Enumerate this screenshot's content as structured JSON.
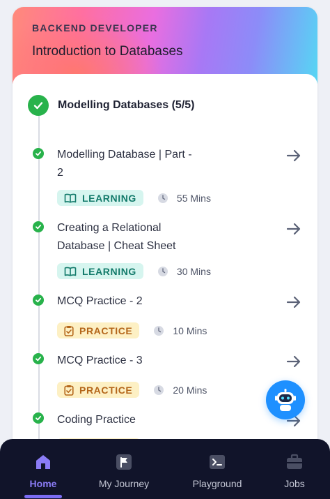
{
  "header": {
    "track": "BACKEND DEVELOPER",
    "course": "Introduction to Databases"
  },
  "module": {
    "title": "Modelling Databases (5/5)"
  },
  "items": [
    {
      "line1": "Modelling Database | Part -",
      "line2": "2",
      "type": "LEARNING",
      "duration": "55 Mins"
    },
    {
      "line1": "Creating a Relational",
      "line2": "Database | Cheat Sheet",
      "type": "LEARNING",
      "duration": "30 Mins"
    },
    {
      "line1": "MCQ Practice - 2",
      "line2": "",
      "type": "PRACTICE",
      "duration": "10 Mins"
    },
    {
      "line1": "MCQ Practice - 3",
      "line2": "",
      "type": "PRACTICE",
      "duration": "20 Mins"
    },
    {
      "line1": "Coding Practice",
      "line2": "",
      "type": "",
      "duration": ""
    }
  ],
  "nav": [
    {
      "label": "Home",
      "icon": "home-icon",
      "active": true
    },
    {
      "label": "My Journey",
      "icon": "flag-icon",
      "active": false
    },
    {
      "label": "Playground",
      "icon": "terminal-icon",
      "active": false
    },
    {
      "label": "Jobs",
      "icon": "briefcase-icon",
      "active": false
    }
  ],
  "colors": {
    "check": "#28b24b",
    "learning_bg": "#d6f5ef",
    "learning_fg": "#127a6a",
    "practice_bg": "#fdf0c4",
    "practice_fg": "#b4661a",
    "nav_bg": "#11142a",
    "nav_active": "#8b7cf6",
    "bot": "#1e90ff"
  }
}
